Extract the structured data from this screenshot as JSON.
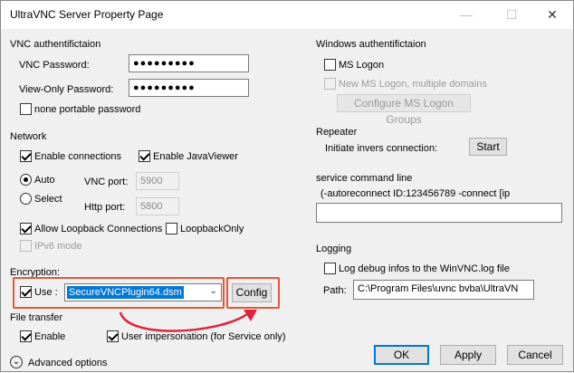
{
  "window": {
    "title": "UltraVNC Server Property Page"
  },
  "vnc_auth": {
    "heading": "VNC authentifictaion",
    "password_label": "VNC Password:",
    "password_value": "●●●●●●●●●",
    "viewonly_label": "View-Only Password:",
    "viewonly_value": "●●●●●●●●●",
    "portable_label": "none portable password"
  },
  "network": {
    "heading": "Network",
    "enable_connections": "Enable connections",
    "enable_javaviewer": "Enable JavaViewer",
    "auto_label": "Auto",
    "select_label": "Select",
    "vnc_port_label": "VNC port:",
    "vnc_port_value": "5900",
    "http_port_label": "Http port:",
    "http_port_value": "5800",
    "allow_loopback": "Allow Loopback Connections",
    "loopback_only": "LoopbackOnly",
    "ipv6": "IPv6 mode"
  },
  "encryption": {
    "heading": "Encryption:",
    "use_label": "Use :",
    "plugin_value": "SecureVNCPlugin64.dsm",
    "config_label": "Config"
  },
  "file_transfer": {
    "heading": "File transfer",
    "enable_label": "Enable",
    "user_impersonation": "User impersonation (for Service only)"
  },
  "advanced": {
    "label": "Advanced options"
  },
  "windows_auth": {
    "heading": "Windows authentifictaion",
    "ms_logon": "MS Logon",
    "new_ms_logon": "New MS Logon, multiple domains",
    "configure_groups": "Configure MS Logon Groups"
  },
  "repeater": {
    "heading": "Repeater",
    "initiate_label": "Initiate invers connection:",
    "start_label": "Start"
  },
  "service": {
    "heading": "service command line",
    "command_text": "(-autoreconnect ID:123456789 -connect [ip"
  },
  "logging": {
    "heading": "Logging",
    "log_debug": "Log debug infos to the WinVNC.log file",
    "path_label": "Path:",
    "path_value": "C:\\Program Files\\uvnc bvba\\UltraVN"
  },
  "buttons": {
    "ok": "OK",
    "apply": "Apply",
    "cancel": "Cancel"
  },
  "colors": {
    "accent": "#0078d7",
    "highlight_box": "#e2583a",
    "arrow": "#e0233a"
  }
}
